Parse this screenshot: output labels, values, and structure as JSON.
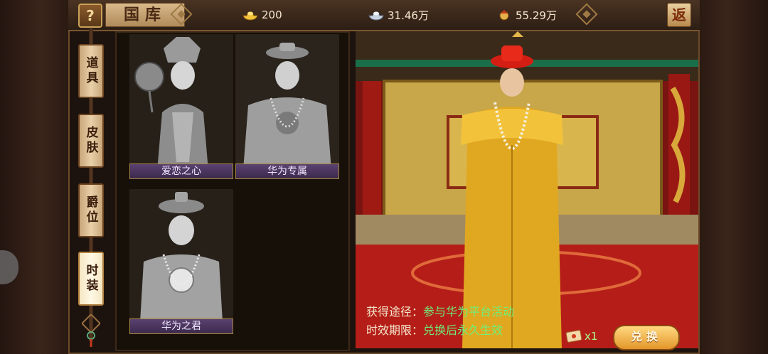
{
  "header": {
    "help_label": "?",
    "title": "国库",
    "back_label": "返",
    "resources": [
      {
        "icon": "gold-ingot-icon",
        "value": "200"
      },
      {
        "icon": "silver-icon",
        "value": "31.46万"
      },
      {
        "icon": "soldier-icon",
        "value": "55.29万"
      }
    ]
  },
  "tabs": [
    {
      "label": "道具",
      "active": false
    },
    {
      "label": "皮肤",
      "active": false
    },
    {
      "label": "爵位",
      "active": false
    },
    {
      "label": "时装",
      "active": true
    }
  ],
  "items": [
    {
      "name": "爱恋之心",
      "selected": false
    },
    {
      "name": "华为专属",
      "selected": true
    },
    {
      "name": "华为之君",
      "selected": false
    }
  ],
  "details": {
    "source_key": "获得途径：",
    "source_value": "参与华为平台活动",
    "duration_key": "时效期限：",
    "duration_value": "兑换后永久生效"
  },
  "exchange": {
    "count": "x1",
    "button_label": "兑换"
  },
  "colors": {
    "selection": "#f5d820",
    "value_green": "#6ef07a",
    "label_purple": "#4a3560"
  }
}
